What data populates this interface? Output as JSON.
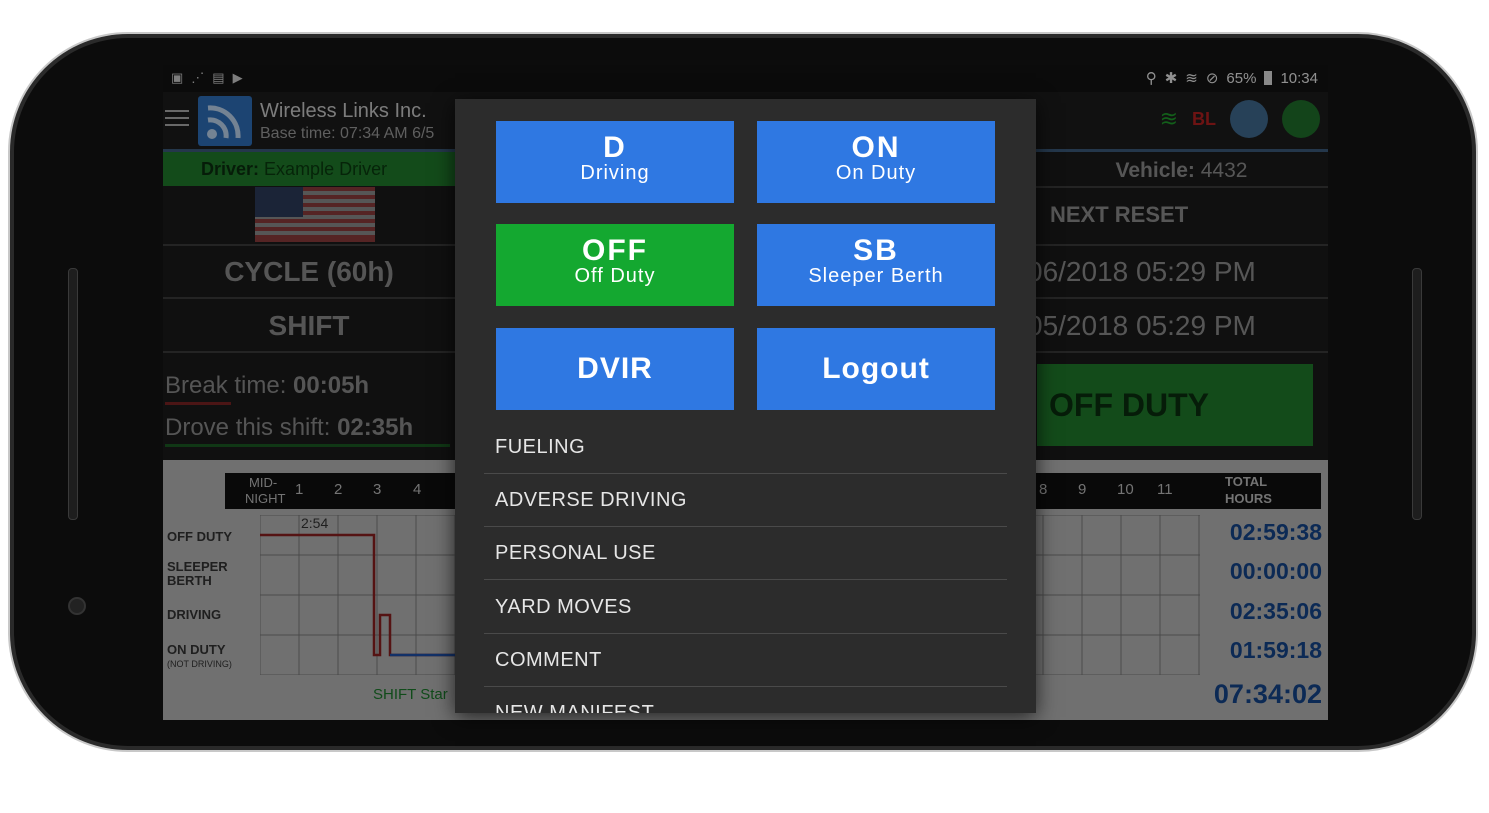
{
  "status_bar": {
    "battery": "65%",
    "time": "10:34"
  },
  "app_bar": {
    "company": "Wireless Links Inc.",
    "base_time": "Base time: 07:34 AM 6/5",
    "bl_label": "BL"
  },
  "driver": {
    "label": "Driver:",
    "name": "Example Driver"
  },
  "left_panel": {
    "cycle": "CYCLE (60h)",
    "shift": "SHIFT",
    "break_label": "Break time:",
    "break_value": "00:05h",
    "drove_label": "Drove this shift:",
    "drove_value": "02:35h"
  },
  "right_panel": {
    "vehicle_label": "Vehicle:",
    "vehicle_value": "4432",
    "next_reset": "NEXT RESET",
    "reset_1": "06/2018 05:29 PM",
    "reset_2": "05/2018 05:29 PM",
    "status": "OFF DUTY"
  },
  "grid": {
    "mid_label_1": "MID-",
    "mid_label_2": "NIGHT",
    "hours_left": [
      "1",
      "2",
      "3",
      "4"
    ],
    "hours_right": [
      "8",
      "9",
      "10",
      "11"
    ],
    "total_label_1": "TOTAL",
    "total_label_2": "HOURS",
    "row_labels": {
      "off_duty": "OFF DUTY",
      "sleeper_1": "SLEEPER",
      "sleeper_2": "BERTH",
      "driving": "DRIVING",
      "on_duty": "ON DUTY",
      "not_driving": "(NOT DRIVING)"
    },
    "marker": "2:54",
    "shift_start": "SHIFT Star",
    "totals": [
      "02:59:38",
      "00:00:00",
      "02:35:06",
      "01:59:18"
    ],
    "grand_total": "07:34:02"
  },
  "dialog": {
    "buttons": [
      {
        "code": "D",
        "desc": "Driving",
        "color": "#2f78e2"
      },
      {
        "code": "ON",
        "desc": "On Duty",
        "color": "#2f78e2"
      },
      {
        "code": "OFF",
        "desc": "Off Duty",
        "color": "#14a830"
      },
      {
        "code": "SB",
        "desc": "Sleeper Berth",
        "color": "#2f78e2"
      }
    ],
    "dvir": "DVIR",
    "logout": "Logout",
    "menu": [
      "FUELING",
      "ADVERSE DRIVING",
      "PERSONAL USE",
      "YARD MOVES",
      "COMMENT",
      "NEW MANIFEST"
    ]
  }
}
